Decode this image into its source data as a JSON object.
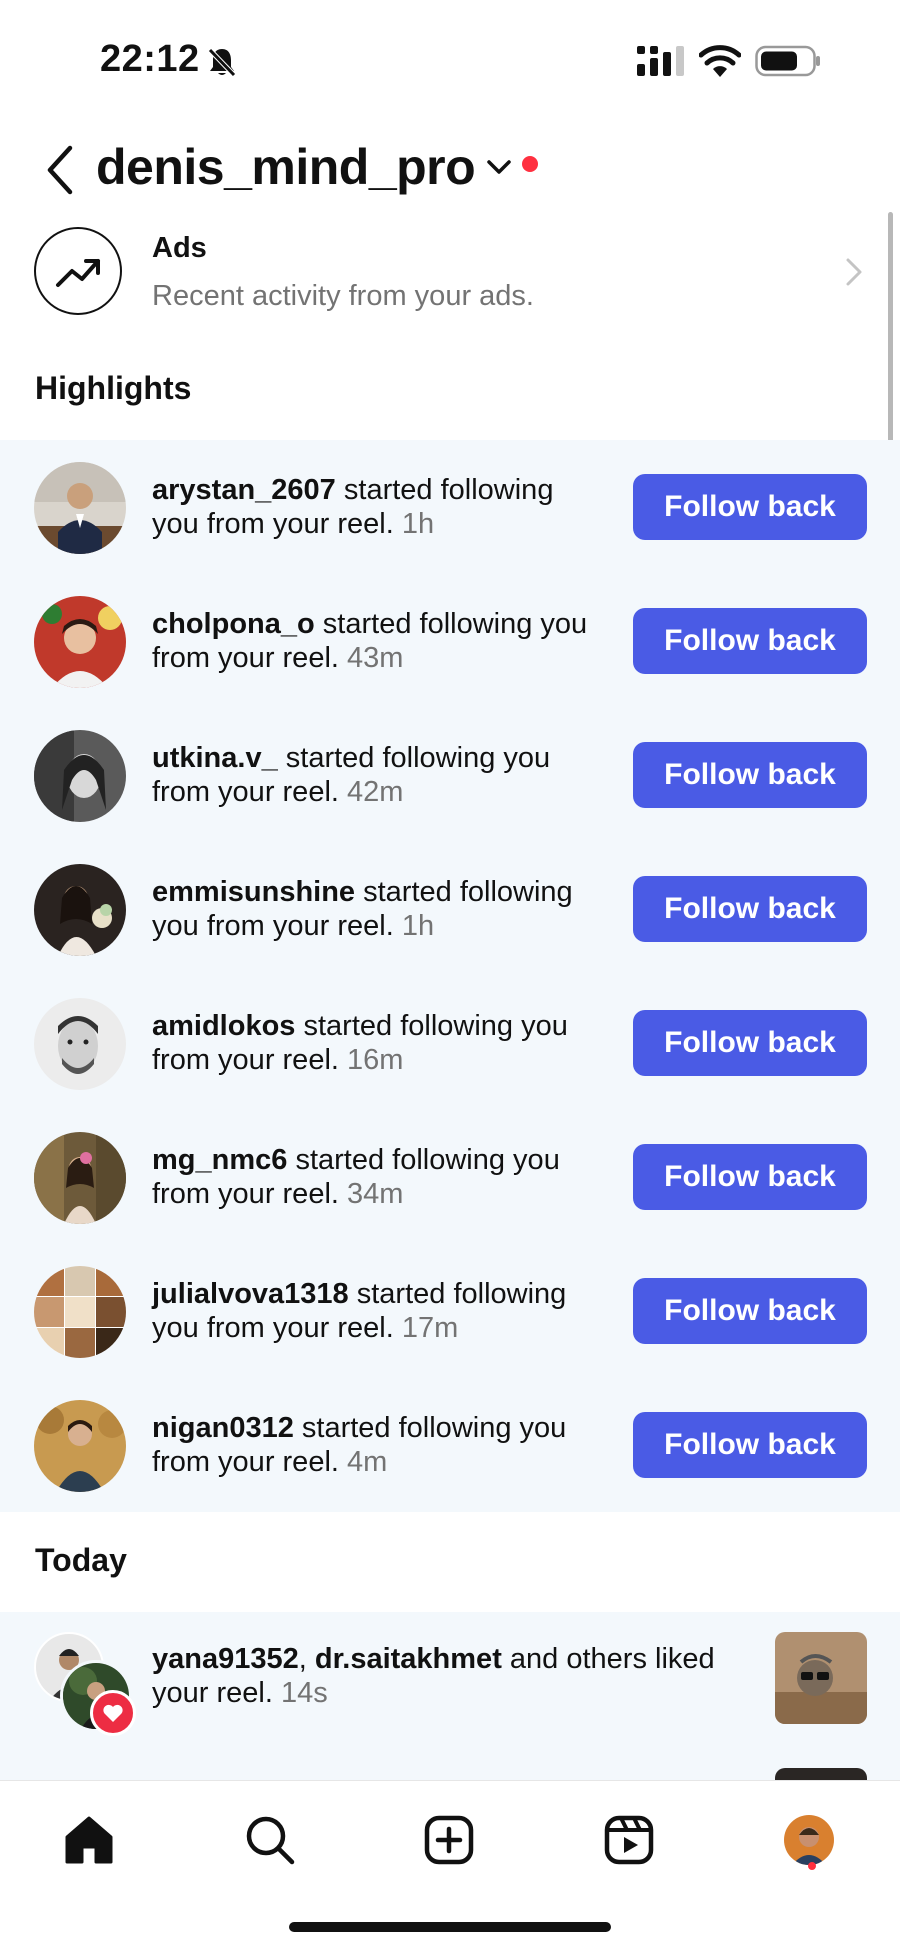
{
  "status_bar": {
    "time": "22:12"
  },
  "header": {
    "account_name": "denis_mind_pro"
  },
  "ads": {
    "title": "Ads",
    "subtitle": "Recent activity from your ads."
  },
  "highlights": {
    "title": "Highlights",
    "items": [
      {
        "username": "arystan_2607",
        "line1": " started following",
        "line2": "you from your reel. ",
        "time": "1h",
        "button": "Follow back"
      },
      {
        "username": "cholpona_o",
        "line1": " started following you",
        "line2": "from your reel. ",
        "time": "43m",
        "button": "Follow back"
      },
      {
        "username": "utkina.v_",
        "line1": " started following you",
        "line2": "from your reel. ",
        "time": "42m",
        "button": "Follow back"
      },
      {
        "username": "emmisunshine",
        "line1": " started following",
        "line2": "you from your reel. ",
        "time": "1h",
        "button": "Follow back"
      },
      {
        "username": "amidlokos",
        "line1": " started following you",
        "line2": "from your reel. ",
        "time": "16m",
        "button": "Follow back"
      },
      {
        "username": "mg_nmc6",
        "line1": " started following you",
        "line2": "from your reel. ",
        "time": "34m",
        "button": "Follow back"
      },
      {
        "username": "julialvova1318",
        "line1": " started following",
        "line2": "you from your reel. ",
        "time": "17m",
        "button": "Follow back"
      },
      {
        "username": "nigan0312",
        "line1": " started following you",
        "line2": "from your reel. ",
        "time": "4m",
        "button": "Follow back"
      }
    ]
  },
  "today": {
    "title": "Today",
    "item": {
      "user1": "yana91352",
      "separator": ", ",
      "user2": "dr.saitakhmet",
      "rest": " and others liked",
      "line2": "your reel. ",
      "time": "14s"
    }
  },
  "tabbar": {
    "icons": [
      "home-icon",
      "search-icon",
      "create-icon",
      "reels-icon",
      "profile-avatar"
    ]
  },
  "colors": {
    "accent": "#4a5be5",
    "notification_red": "#ff3040",
    "highlight_bg": "#f3f8fc",
    "secondary_text": "#737373"
  }
}
